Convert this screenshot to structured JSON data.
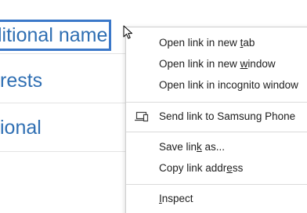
{
  "background": {
    "links": [
      {
        "text": "litional name",
        "focused": true
      },
      {
        "text": "rests",
        "focused": false
      },
      {
        "text": "ional",
        "focused": false
      }
    ],
    "link_color": "#2f6fb3",
    "focus_color": "#3b78c9"
  },
  "context_menu": {
    "groups": [
      [
        {
          "pre": "Open link in new ",
          "key": "t",
          "post": "ab"
        },
        {
          "pre": "Open link in new ",
          "key": "w",
          "post": "indow"
        },
        {
          "pre": "Open link in incognito window",
          "key": "",
          "post": ""
        }
      ],
      [
        {
          "pre": "Send link to Samsung Phone",
          "key": "",
          "post": "",
          "icon": "send-to-device-icon"
        }
      ],
      [
        {
          "pre": "Save lin",
          "key": "k",
          "post": " as..."
        },
        {
          "pre": "Copy link addr",
          "key": "e",
          "post": "ss"
        }
      ],
      [
        {
          "pre": "",
          "key": "I",
          "post": "nspect"
        }
      ]
    ]
  }
}
